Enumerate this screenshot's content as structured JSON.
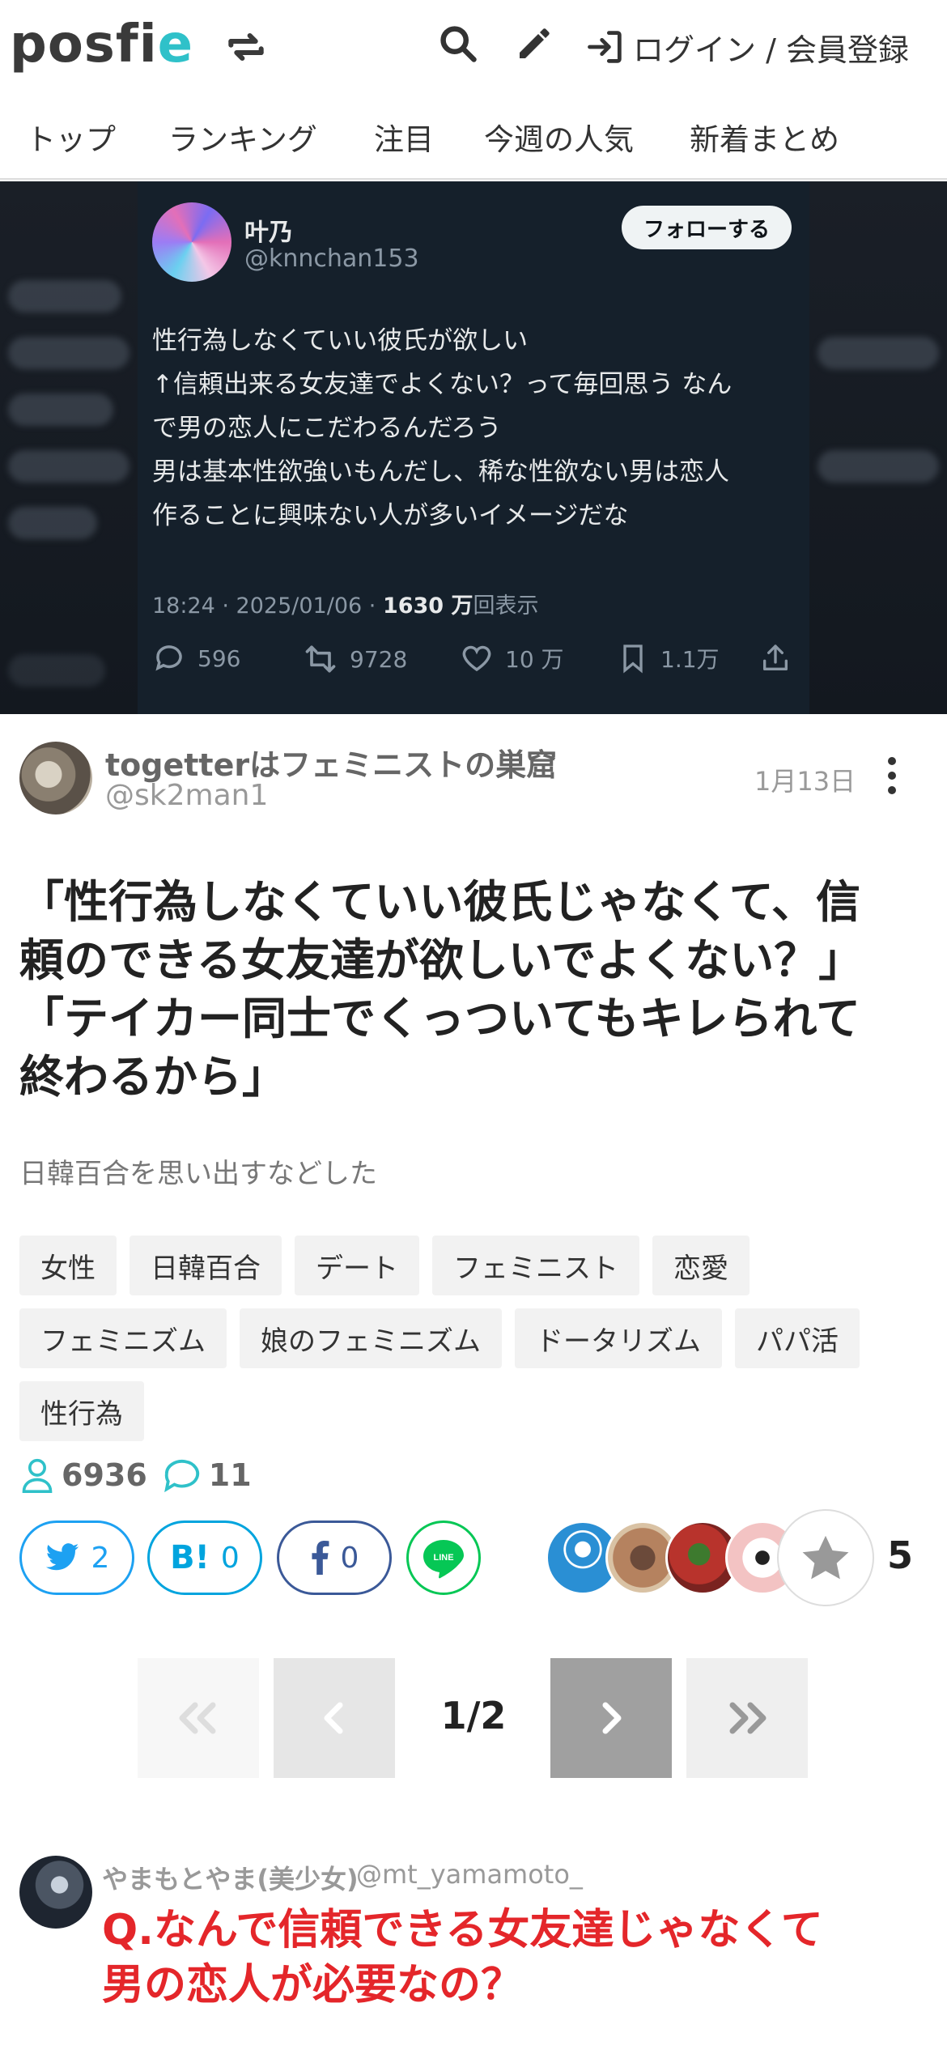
{
  "header": {
    "logo_main": "posfi",
    "logo_accent": "e",
    "login_label": "ログイン / 会員登録"
  },
  "nav": {
    "items": [
      "トップ",
      "ランキング",
      "注目",
      "今週の人気",
      "新着まとめ"
    ]
  },
  "tweet": {
    "name": "叶乃",
    "handle": "@knnchan153",
    "follow_label": "フォローする",
    "body_lines": [
      "性行為しなくていい彼氏が欲しい",
      "↑信頼出来る女友達でよくない？って毎回思う なん",
      "で男の恋人にこだわるんだろう",
      "男は基本性欲強いもんだし、稀な性欲ない男は恋人",
      "作ることに興味ない人が多いイメージだな"
    ],
    "meta_time": "18:24 · 2025/01/06 · ",
    "meta_views": "1630 万",
    "meta_views_suffix": "回表示",
    "replies": "596",
    "retweets": "9728",
    "likes": "10 万",
    "bookmarks": "1.1万"
  },
  "author": {
    "name": "togetterはフェミニストの巣窟",
    "handle": "@sk2man1",
    "date": "1月13日"
  },
  "article": {
    "title_lines": [
      "「性行為しなくていい彼氏じゃなくて、信",
      "頼のできる女友達が欲しいでよくない？」",
      "「テイカー同士でくっついてもキレられて",
      "終わるから」"
    ],
    "subtitle": "日韓百合を思い出すなどした"
  },
  "tags": [
    "女性",
    "日韓百合",
    "デート",
    "フェミニスト",
    "恋愛",
    "フェミニズム",
    "娘のフェミニズム",
    "ドータリズム",
    "パパ活",
    "性行為"
  ],
  "stats": {
    "views": "6936",
    "comments": "11"
  },
  "share": {
    "twitter_count": "2",
    "hatena_count": "0",
    "facebook_count": "0",
    "hatena_logo": "B!",
    "line_logo": "LINE",
    "favorites_count": "5"
  },
  "pagination": {
    "label": "1/2"
  },
  "comment": {
    "name": "やまもとやま(美少女)",
    "handle": "@mt_yamamoto_",
    "text_lines": [
      "Q.なんで信頼できる女友達じゃなくて",
      "男の恋人が必要なの？"
    ]
  },
  "colors": {
    "brand_accent": "#2fc1c9",
    "twitter": "#1da1f2",
    "hatena": "#00a4de",
    "facebook": "#3b5998",
    "line": "#06c755",
    "comment_red": "#e4262a",
    "tweet_bg": "#15202b"
  },
  "icons": {
    "refresh": "refresh-icon",
    "search": "search-icon",
    "edit": "pen-icon",
    "login": "login-icon",
    "reply": "reply-icon",
    "retweet": "retweet-icon",
    "like": "heart-icon",
    "bookmark": "bookmark-icon",
    "share": "share-icon",
    "menu": "kebab-icon",
    "viewer": "person-icon",
    "comment": "comment-icon",
    "favorite": "star-icon"
  }
}
